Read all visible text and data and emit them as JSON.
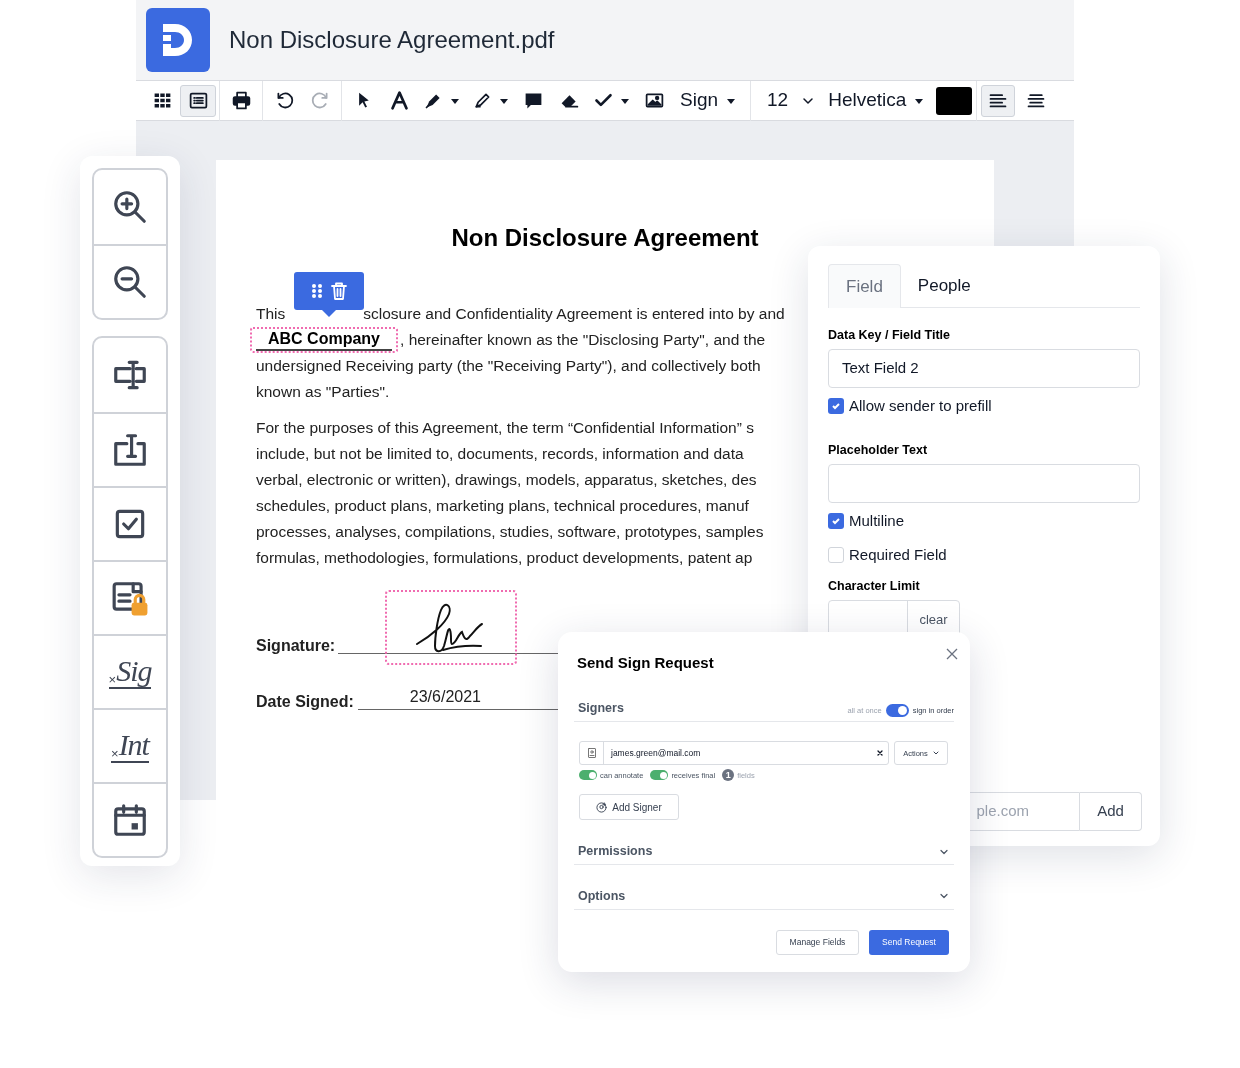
{
  "app": {
    "title": "Non Disclosure Agreement.pdf"
  },
  "toolbar": {
    "buttons": [
      {
        "selected": false,
        "disabled": false
      },
      {
        "selected": true,
        "disabled": false
      },
      {
        "selected": false,
        "disabled": false
      },
      {
        "selected": false,
        "disabled": false
      },
      {
        "selected": false,
        "disabled": true
      },
      {
        "selected": false,
        "disabled": false
      },
      {
        "selected": false,
        "disabled": false
      },
      {
        "selected": false,
        "disabled": false
      },
      {
        "selected": false,
        "disabled": false
      },
      {
        "selected": false,
        "disabled": false
      },
      {
        "selected": false,
        "disabled": false
      },
      {
        "selected": false,
        "disabled": false
      },
      {
        "selected": false,
        "disabled": false
      }
    ],
    "sign_menu": "Sign",
    "font_size": "12",
    "font_family": "Helvetica",
    "align_buttons": [
      {
        "selected": true
      },
      {
        "selected": false
      }
    ]
  },
  "zoom_tools": [
    {
      "kind": "zoom-in"
    },
    {
      "kind": "zoom-out"
    }
  ],
  "field_tools": [
    {
      "kind": "text-field"
    },
    {
      "kind": "text-area"
    },
    {
      "kind": "checkbox"
    },
    {
      "kind": "dropdown-locked"
    },
    {
      "kind": "signature",
      "mark": "×",
      "label": "Sig"
    },
    {
      "kind": "initials",
      "mark": "×",
      "label": "Int"
    },
    {
      "kind": "date"
    }
  ],
  "document": {
    "title": "Non Disclosure Agreement",
    "first_line_start": "This",
    "first_line_end": "sclosure and Confidentiality Agreement is entered into by and",
    "company_field": "ABC Company",
    "paragraph_1": [
      ", hereinafter known as the \"Disclosing Party\", and the",
      "undersigned Receiving party (the \"Receiving Party\"), and collectively both",
      "known as \"Parties\"."
    ],
    "paragraph_2": [
      "For the purposes of this Agreement, the term “Confidential Information” s",
      "include, but not be limited to, documents, records, information and data",
      "verbal, electronic or written), drawings, models, apparatus, sketches, des",
      "schedules, product plans, marketing plans, technical procedures, manuf",
      "processes, analyses, compilations, studies, software, prototypes, samples",
      "formulas, methodologies, formulations, product developments, patent ap"
    ],
    "signature_label": "Signature:",
    "date_label": "Date Signed:",
    "date_value": "23/6/2021"
  },
  "field_panel": {
    "tabs": [
      {
        "label": "Field",
        "selected": true
      },
      {
        "label": "People",
        "selected": false
      }
    ],
    "data_key_label": "Data Key / Field Title",
    "data_key_value": "Text Field 2",
    "allow_prefill": {
      "label": "Allow sender to prefill",
      "checked": true
    },
    "placeholder_label": "Placeholder Text",
    "multiline": {
      "label": "Multiline",
      "checked": true
    },
    "required": {
      "label": "Required Field",
      "checked": false
    },
    "char_limit_label": "Character Limit",
    "clear_button": "clear",
    "email_value": "ple.com",
    "add_button": "Add"
  },
  "modal": {
    "title": "Send Sign Request",
    "signers_heading": "Signers",
    "order_toggle": {
      "off_label": "all at once",
      "on_label": "sign in order",
      "on": true
    },
    "signer_email": "james.green@mail.com",
    "actions": "Actions",
    "signer_toggles": [
      {
        "label": "can annotate",
        "on": true
      },
      {
        "label": "receives final",
        "on": true
      }
    ],
    "fields_count": "1",
    "fields_label": "fields",
    "add_signer": "Add Signer",
    "sections": [
      {
        "label": "Permissions",
        "expanded": false
      },
      {
        "label": "Options",
        "expanded": false
      }
    ],
    "buttons": [
      "Manage Fields",
      "Send Request"
    ]
  }
}
